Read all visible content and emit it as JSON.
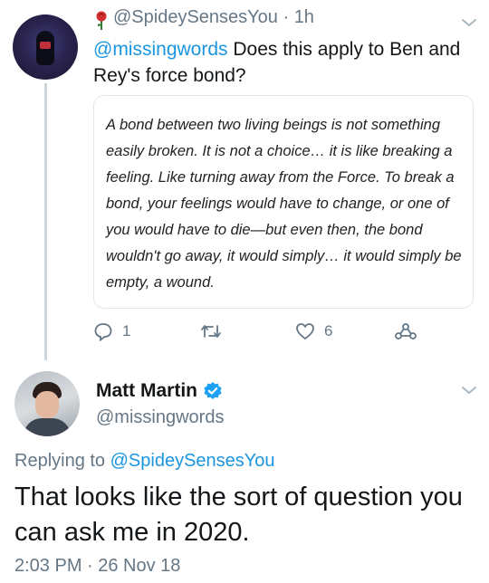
{
  "reply_tweet": {
    "handle_time": "@SpideySensesYou · 1h",
    "mention": "@missingwords",
    "text": " Does this apply to Ben and Rey's force bond?",
    "quote": "A bond between two living beings is not something easily broken. It is not a choice… it is like breaking a feeling. Like turning away from the Force. To break a bond, your feelings would have to change, or one of you would have to die—but even then, the bond wouldn't go away, it would simply… it would simply be empty, a wound.",
    "reply_count": "1",
    "like_count": "6",
    "icons": [
      "rose-icon",
      "chevron-down-icon",
      "reply-icon",
      "retweet-icon",
      "heart-icon",
      "share-icon"
    ]
  },
  "main_tweet": {
    "name": "Matt Martin",
    "handle": "@missingwords",
    "replying_prefix": "Replying to ",
    "replying_to": "@SpideySensesYou",
    "text": "That looks like the sort of question you can ask me in 2020.",
    "timestamp": "2:03 PM · 26 Nov 18",
    "icons": [
      "verified-icon",
      "chevron-down-icon"
    ]
  },
  "colors": {
    "link": "#1b95e0",
    "muted": "#657786",
    "verified": "#1da1f2"
  }
}
